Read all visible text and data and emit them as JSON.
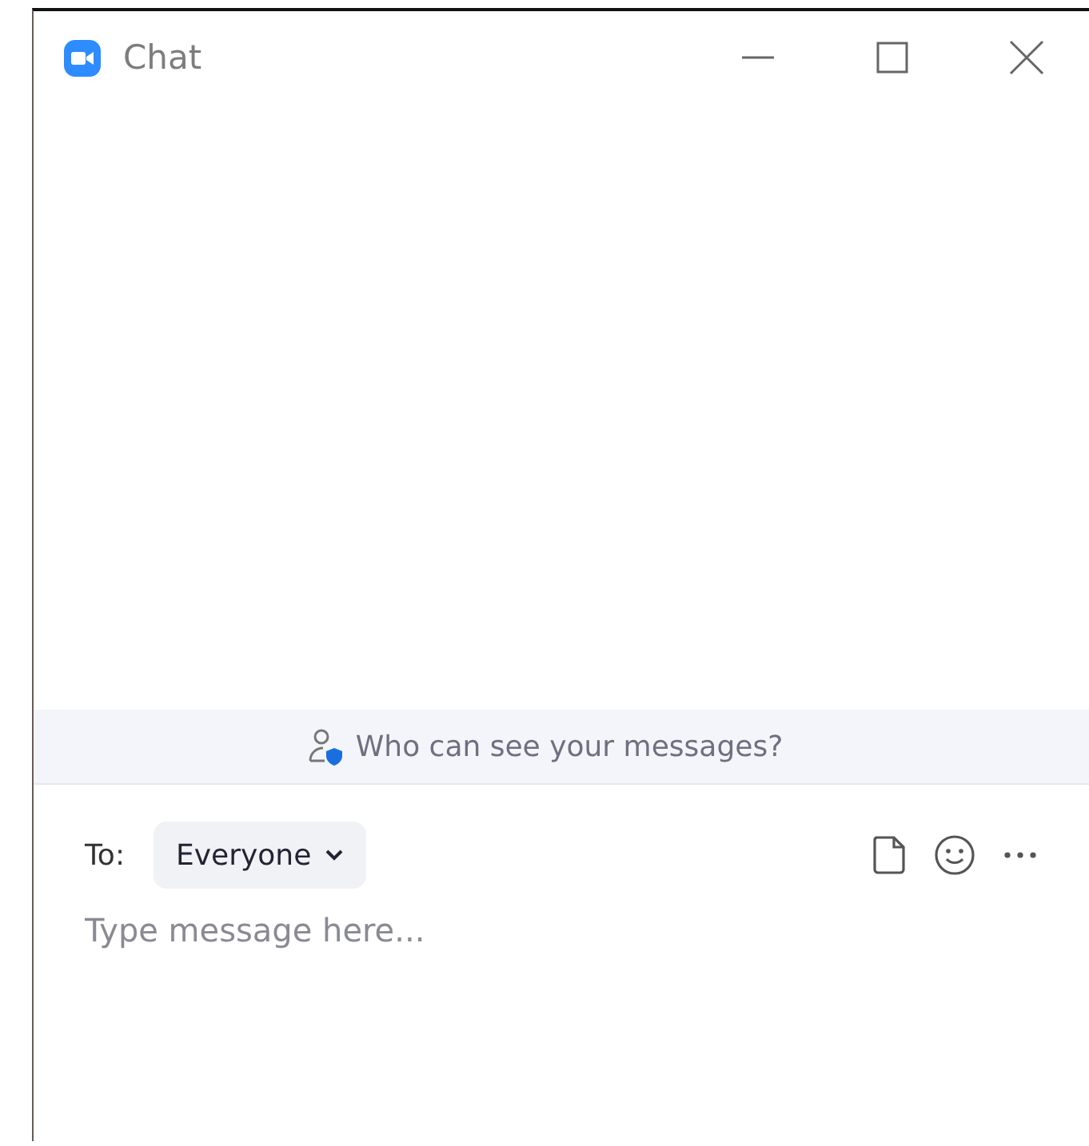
{
  "window": {
    "title": "Chat"
  },
  "privacy_banner": {
    "text": "Who can see your messages?"
  },
  "compose": {
    "to_label": "To:",
    "recipient": "Everyone",
    "placeholder": "Type message here..."
  }
}
